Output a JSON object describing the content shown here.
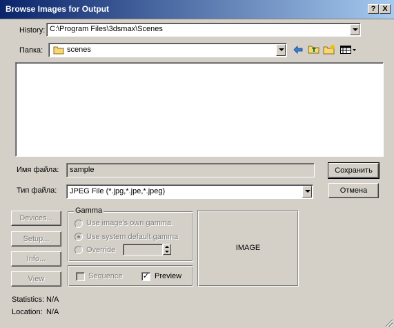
{
  "window": {
    "title": "Browse Images for Output",
    "help_btn": "?",
    "close_btn": "X"
  },
  "history": {
    "label": "History:",
    "value": "C:\\Program Files\\3dsmax\\Scenes"
  },
  "folder": {
    "label": "Папка:",
    "value": "scenes"
  },
  "filename": {
    "label": "Имя файла:",
    "value": "sample"
  },
  "filetype": {
    "label": "Тип файла:",
    "value": "JPEG File (*.jpg,*.jpe,*.jpeg)"
  },
  "buttons": {
    "save": "Сохранить",
    "cancel": "Отмена",
    "devices": "Devices...",
    "setup": "Setup...",
    "info": "Info...",
    "view": "View"
  },
  "gamma": {
    "title": "Gamma",
    "opt_own": "Use image's own gamma",
    "opt_default": "Use system default gamma",
    "opt_override": "Override",
    "selected": "Use system default gamma"
  },
  "options": {
    "sequence": "Sequence",
    "sequence_checked": false,
    "preview": "Preview",
    "preview_checked": true
  },
  "preview_area": {
    "text": "IMAGE"
  },
  "info": {
    "statistics_label": "Statistics:",
    "statistics_value": "N/A",
    "location_label": "Location:",
    "location_value": "N/A"
  }
}
